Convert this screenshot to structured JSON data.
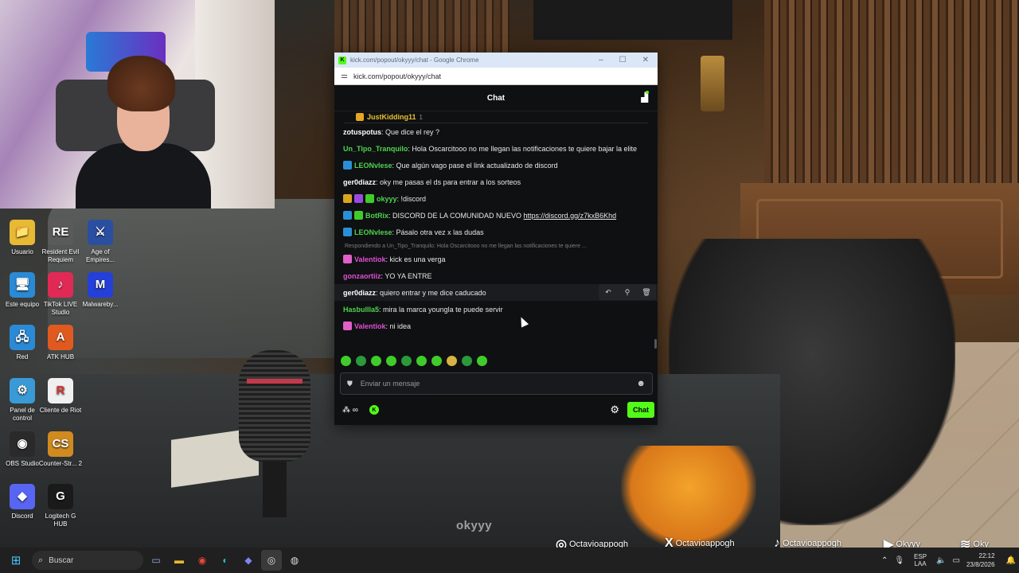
{
  "window": {
    "title": "kick.com/popout/okyyy/chat - Google Chrome",
    "url": "kick.com/popout/okyyy/chat"
  },
  "chat": {
    "header": "Chat",
    "pinned": {
      "user": "JustKidding11",
      "count": "1"
    },
    "messages": [
      {
        "user": "zotuspotus",
        "color": "#ffffff",
        "text": "Que dice el rey ?",
        "badges": []
      },
      {
        "user": "Un_Tipo_Tranquilo",
        "color": "#4fd34f",
        "text": "Hola Oscarcitooo no me llegan las notificaciones te quiere bajar la elite",
        "badges": []
      },
      {
        "user": "LEONvlese",
        "color": "#4fd34f",
        "text": "Que algún vago pase el link actualizado de discord",
        "badges": [
          "#2b8fd6"
        ]
      },
      {
        "user": "ger0diazz",
        "color": "#ffffff",
        "text": "oky me pasas el ds para entrar a los sorteos",
        "badges": []
      },
      {
        "user": "okyyy",
        "color": "#4fd34f",
        "text": "!discord",
        "badges": [
          "#d9a520",
          "#9b4ae0",
          "#3fcc2b"
        ]
      },
      {
        "user": "BotRix",
        "color": "#4fd34f",
        "text": "DISCORD DE LA COMUNIDAD NUEVO ",
        "link": "https://discord.gg/z7kxB6Khd",
        "badges": [
          "#2b8fd6",
          "#3fcc2b"
        ]
      },
      {
        "user": "LEONvlese",
        "color": "#4fd34f",
        "text": "Pásalo otra vez x las dudas",
        "badges": [
          "#2b8fd6"
        ]
      },
      {
        "reply": "Respondiendo a Un_Tipo_Tranquilo: Hola Oscarcitooo no me llegan las notificaciones te quiere ...",
        "user": "Valentiok",
        "color": "#e04fd3",
        "text": "kick es una verga",
        "badges": [
          "#e060c8"
        ]
      },
      {
        "user": "gonzaortiiz",
        "color": "#e04fd3",
        "text": "YO YA ENTRE",
        "badges": []
      },
      {
        "user": "ger0diazz",
        "color": "#ffffff",
        "text": "quiero entrar y me dice caducado",
        "badges": [],
        "hover": true
      },
      {
        "user": "Hasbullla5",
        "color": "#4fd34f",
        "text": "mira la marca youngla te puede servir",
        "badges": []
      },
      {
        "user": "Valentiok",
        "color": "#e04fd3",
        "text": "ni idea",
        "badges": [
          "#e060c8"
        ]
      }
    ],
    "input_placeholder": "Enviar un mensaje",
    "send_label": "Chat"
  },
  "desktop_icons": [
    {
      "label": "Usuario",
      "glyph": "📁",
      "bg": "#e8b935"
    },
    {
      "label": "Resident Evil Requiem",
      "glyph": "RE",
      "bg": "#5a5a5a"
    },
    {
      "label": "Age of Empires...",
      "glyph": "⚔",
      "bg": "#2b4fa0"
    },
    {
      "label": "Este equipo",
      "glyph": "🖥",
      "bg": "#2a8ad6"
    },
    {
      "label": "TikTok LIVE Studio",
      "glyph": "♪",
      "bg": "#e02a55"
    },
    {
      "label": "Malwareby...",
      "glyph": "M",
      "bg": "#2540d8"
    },
    {
      "label": "Red",
      "glyph": "🖧",
      "bg": "#2a8ad6"
    },
    {
      "label": "ATK HUB",
      "glyph": "A",
      "bg": "#e05a20"
    },
    {
      "label": "Panel de control",
      "glyph": "⚙",
      "bg": "#3a9ad6"
    },
    {
      "label": "Cliente de Riot",
      "glyph": "R",
      "bg": "#f0f0f0"
    },
    {
      "label": "OBS Studio",
      "glyph": "◉",
      "bg": "#2a2a2a"
    },
    {
      "label": "Counter-Str... 2",
      "glyph": "CS",
      "bg": "#d08a20"
    },
    {
      "label": "Discord",
      "glyph": "◆",
      "bg": "#5865f2"
    },
    {
      "label": "Logitech G HUB",
      "glyph": "G",
      "bg": "#1a1a1a"
    }
  ],
  "overlay": {
    "watermark": "okyyy",
    "socials": [
      {
        "network": "instagram-icon",
        "glyph": "◎",
        "handle": "Octavioappogh"
      },
      {
        "network": "x-icon",
        "glyph": "X",
        "handle": "Octavioappogh"
      },
      {
        "network": "tiktok-icon",
        "glyph": "♪",
        "handle": "Octavioappogh"
      },
      {
        "network": "youtube-icon",
        "glyph": "▶",
        "handle": "Okyyy"
      },
      {
        "network": "spotify-icon",
        "glyph": "≋",
        "handle": "Oky"
      }
    ]
  },
  "taskbar": {
    "search_placeholder": "Buscar",
    "lang_top": "ESP",
    "lang_bottom": "LAA",
    "time": "22:12",
    "date": "23/8/2026"
  },
  "colors": {
    "kick_green": "#53fc18",
    "chat_bg": "#0f1012"
  }
}
